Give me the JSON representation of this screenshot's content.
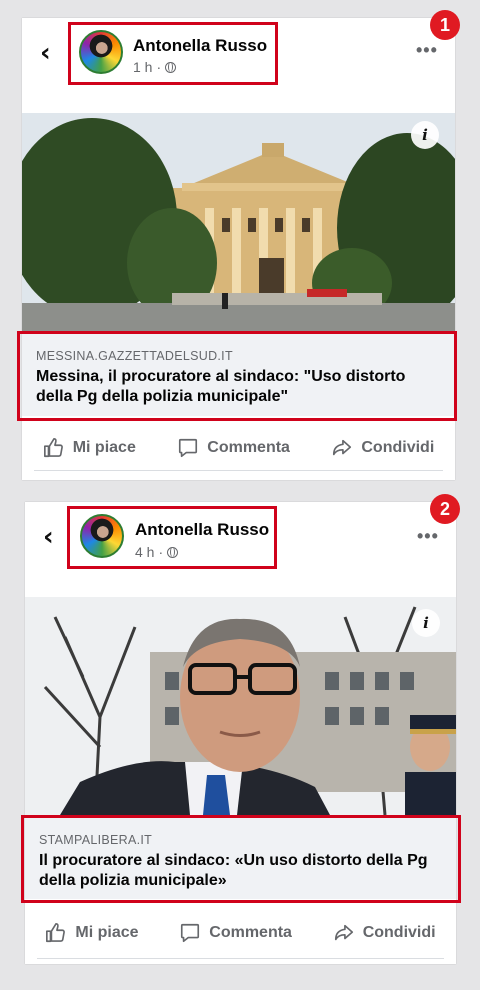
{
  "posts": [
    {
      "badge": "1",
      "author": "Antonella Russo",
      "time": "1 h",
      "domain": "MESSINA.GAZZETTADELSUD.IT",
      "headline": "Messina, il procuratore al sindaco: \"Uso distorto della Pg della polizia municipale\"",
      "actions": {
        "like": "Mi piace",
        "comment": "Commenta",
        "share": "Condividi"
      }
    },
    {
      "badge": "2",
      "author": "Antonella Russo",
      "time": "4 h",
      "domain": "STAMPALIBERA.IT",
      "headline": "Il procuratore al sindaco: «Un uso distorto della Pg della polizia municipale»",
      "actions": {
        "like": "Mi piace",
        "comment": "Commenta",
        "share": "Condividi"
      }
    }
  ],
  "icons": {
    "back": "chevron-left-icon",
    "more": "more-horizontal-icon",
    "privacy": "globe-icon",
    "info": "info-icon",
    "like": "thumbs-up-icon",
    "comment": "comment-icon",
    "share": "share-icon"
  },
  "colors": {
    "highlight": "#d0021b",
    "badge": "#e01a22",
    "link_bar": "#f0f2f5",
    "muted_text": "#65676b"
  }
}
